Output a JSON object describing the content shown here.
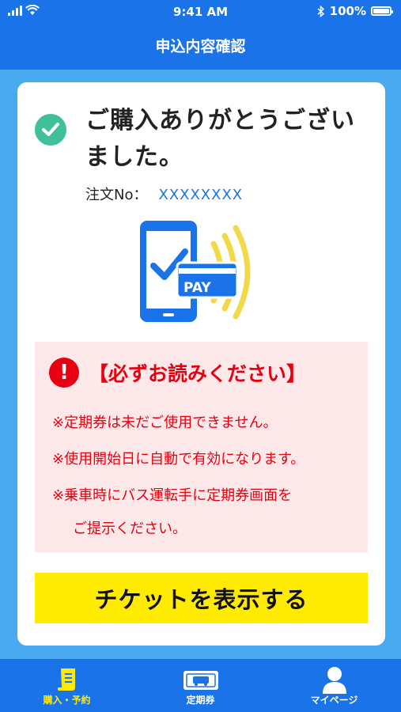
{
  "status_bar": {
    "time": "9:41 AM",
    "battery": "100%",
    "battery_level": 1.0
  },
  "nav": {
    "title": "申込内容確認"
  },
  "confirmation": {
    "message": "ご購入ありがとうございました。",
    "order_label": "注文No：",
    "order_number": "XXXXXXXX",
    "pay_text": "PAY"
  },
  "notice": {
    "icon_text": "!",
    "title": "【必ずお読みください】",
    "lines": [
      "※定期券は未だご使用できません。",
      "※使用開始日に自動で有効になります。",
      "※乗車時にバス運転手に定期券画面を",
      "ご提示ください。"
    ]
  },
  "cta": {
    "label": "チケットを表示する"
  },
  "tabs": [
    {
      "label": "購入・予約",
      "active": true
    },
    {
      "label": "定期券",
      "active": false
    },
    {
      "label": "マイページ",
      "active": false
    }
  ],
  "colors": {
    "primary": "#1a73e8",
    "background": "#4aaaf0",
    "check": "#3fbf9a",
    "alert": "#e60012",
    "notice_bg": "#fce8e8",
    "cta": "#ffeb00",
    "tab_active": "#ffeb00"
  }
}
